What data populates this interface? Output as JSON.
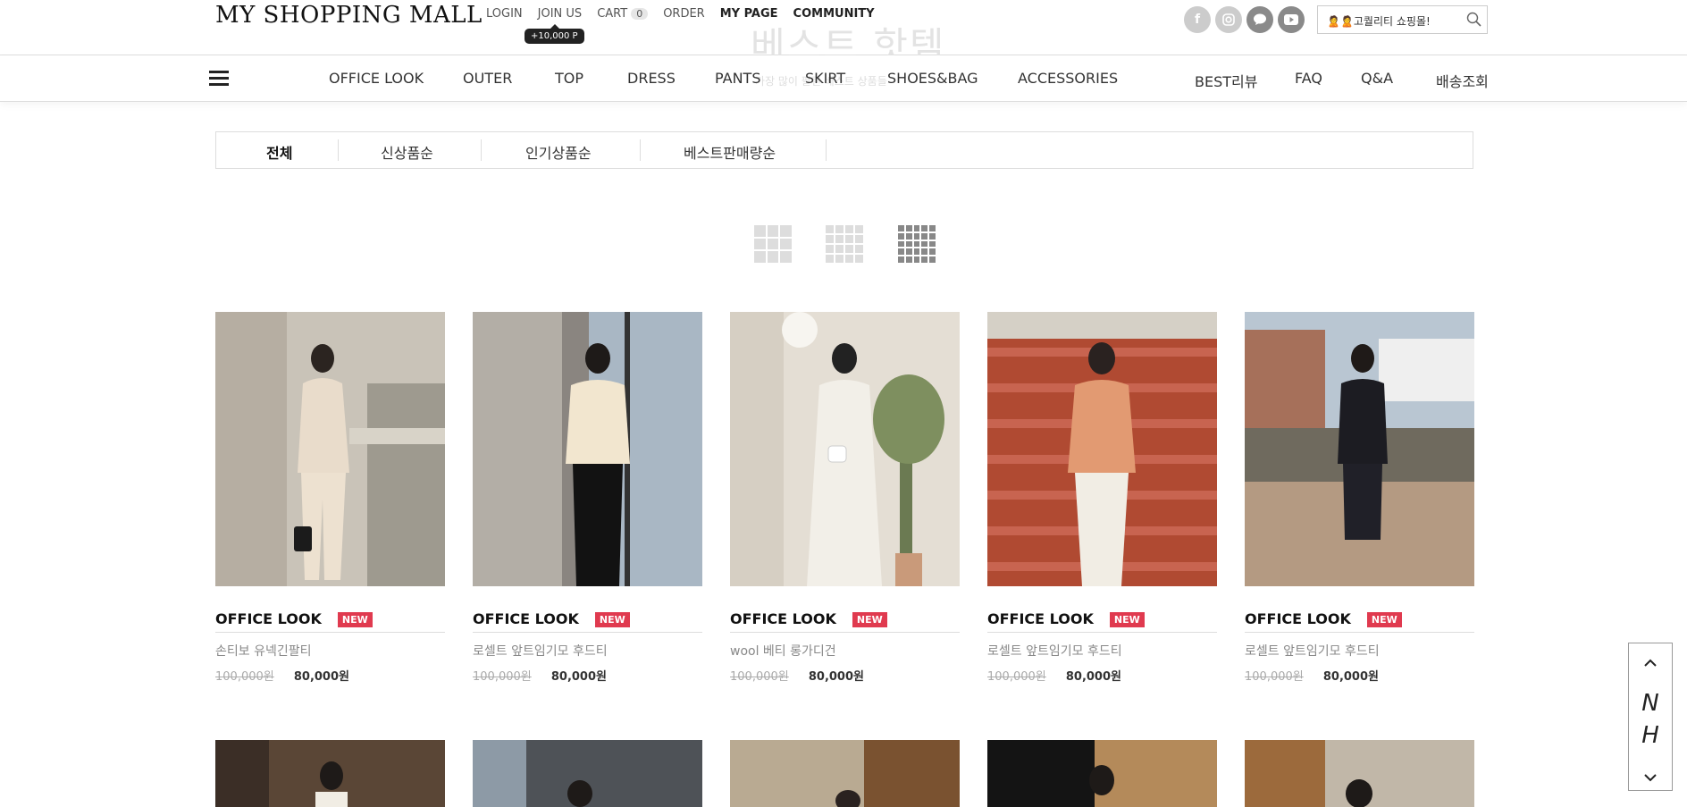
{
  "header": {
    "logo": "MY SHOPPING MALL",
    "links": [
      {
        "label": "LOGIN",
        "strong": false
      },
      {
        "label": "JOIN US",
        "strong": false
      },
      {
        "label": "CART",
        "strong": false
      },
      {
        "label": "ORDER",
        "strong": false
      },
      {
        "label": "MY PAGE",
        "strong": true
      },
      {
        "label": "COMMUNITY",
        "strong": true
      }
    ],
    "cart_count": "0",
    "join_point_badge": "+10,000 P",
    "ghost_title": "베스트 핫템",
    "social": [
      {
        "name": "facebook-icon",
        "glyph": "f"
      },
      {
        "name": "instagram-icon",
        "glyph": "◎"
      },
      {
        "name": "kakaotalk-icon",
        "glyph": "●"
      },
      {
        "name": "youtube-icon",
        "glyph": "▶"
      }
    ],
    "search_value": "🙎🙎고퀄리티 쇼핑몰!"
  },
  "nav": {
    "items": [
      "OFFICE LOOK",
      "OUTER",
      "TOP",
      "DRESS",
      "PANTS",
      "SKIRT",
      "SHOES&BAG",
      "ACCESSORIES",
      "BEST리뷰",
      "FAQ",
      "Q&A",
      "배송조회"
    ],
    "ghost_subtitle": "가장 많이 팔린 베스트 상품들"
  },
  "sort": {
    "items": [
      "전체",
      "신상품순",
      "인기상품순",
      "베스트판매량순"
    ],
    "active_index": 0
  },
  "grid_views": [
    "3-column-icon",
    "4-column-icon",
    "5-column-icon"
  ],
  "products": [
    {
      "category": "OFFICE LOOK",
      "badge": "NEW",
      "name": "손티보 유넥긴팔티",
      "price_old": "100,000원",
      "price": "80,000원"
    },
    {
      "category": "OFFICE LOOK",
      "badge": "NEW",
      "name": "로셀트 앞트임기모 후드티",
      "price_old": "100,000원",
      "price": "80,000원"
    },
    {
      "category": "OFFICE LOOK",
      "badge": "NEW",
      "name": "wool 베티 롱가디건",
      "price_old": "100,000원",
      "price": "80,000원"
    },
    {
      "category": "OFFICE LOOK",
      "badge": "NEW",
      "name": "로셀트 앞트임기모 후드티",
      "price_old": "100,000원",
      "price": "80,000원"
    },
    {
      "category": "OFFICE LOOK",
      "badge": "NEW",
      "name": "로셀트 앞트임기모 후드티",
      "price_old": "100,000원",
      "price": "80,000원"
    }
  ],
  "quickbar": {
    "up": "⌃",
    "letter1": "N",
    "letter2": "H",
    "down": "⌄"
  },
  "colors": {
    "badge": "#e03a4f",
    "text": "#222222",
    "muted": "#888888"
  }
}
